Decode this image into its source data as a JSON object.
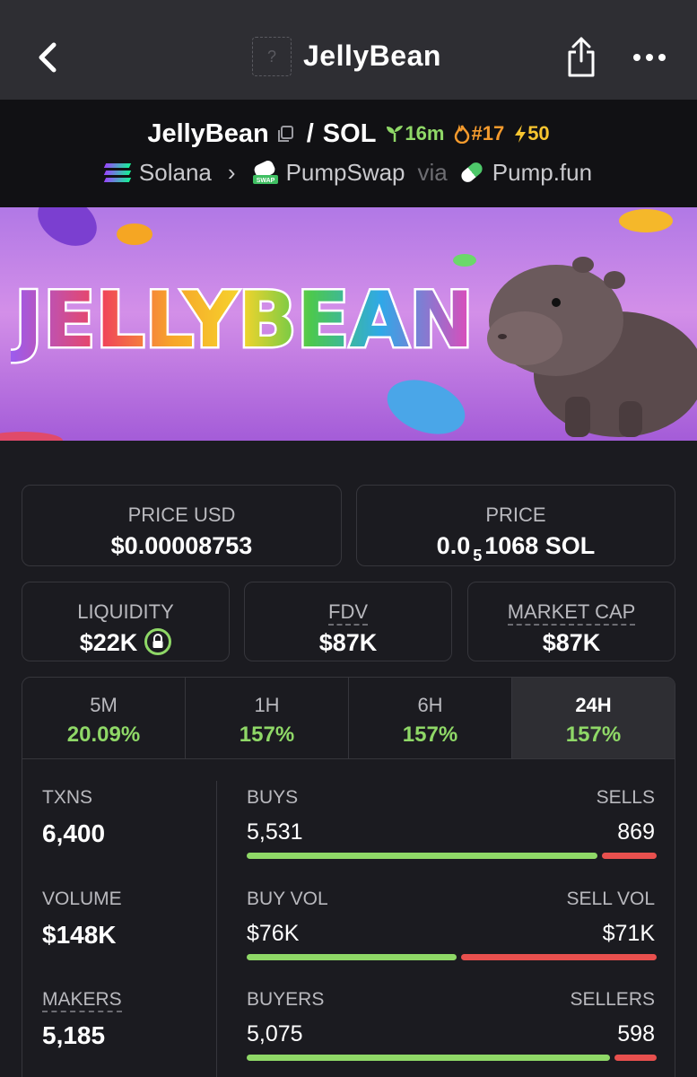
{
  "header": {
    "title": "JellyBean",
    "logo_placeholder": "?"
  },
  "pair": {
    "base": "JellyBean",
    "separator": "/",
    "quote": "SOL",
    "age": "16m",
    "rank": "#17",
    "boost": "50"
  },
  "route": {
    "chain": "Solana",
    "dex": "PumpSwap",
    "via": "via",
    "launchpad": "Pump.fun"
  },
  "banner": {
    "text": "JELLYBEAN"
  },
  "price": {
    "usd_label": "PRICE USD",
    "usd_value": "$0.00008753",
    "native_label": "PRICE",
    "native_prefix": "0.0",
    "native_zeros": "5",
    "native_digits": "1068 SOL"
  },
  "metrics": {
    "liquidity_label": "LIQUIDITY",
    "liquidity_value": "$22K",
    "fdv_label": "FDV",
    "fdv_value": "$87K",
    "mcap_label": "MARKET CAP",
    "mcap_value": "$87K"
  },
  "tabs": [
    {
      "label": "5M",
      "change": "20.09%"
    },
    {
      "label": "1H",
      "change": "157%"
    },
    {
      "label": "6H",
      "change": "157%"
    },
    {
      "label": "24H",
      "change": "157%"
    }
  ],
  "stats": {
    "txns_label": "TXNS",
    "txns_value": "6,400",
    "buys_label": "BUYS",
    "buys_value": "5,531",
    "sells_label": "SELLS",
    "sells_value": "869",
    "buys_fraction": 0.864,
    "volume_label": "VOLUME",
    "volume_value": "$148K",
    "buyvol_label": "BUY VOL",
    "buyvol_value": "$76K",
    "sellvol_label": "SELL VOL",
    "sellvol_value": "$71K",
    "buyvol_fraction": 0.517,
    "makers_label": "MAKERS",
    "makers_value": "5,185",
    "buyers_label": "BUYERS",
    "buyers_value": "5,075",
    "sellers_label": "SELLERS",
    "sellers_value": "598",
    "buyers_fraction": 0.895
  },
  "colors": {
    "positive": "#8fd867",
    "negative": "#e8504e",
    "background": "#1b1b20"
  }
}
